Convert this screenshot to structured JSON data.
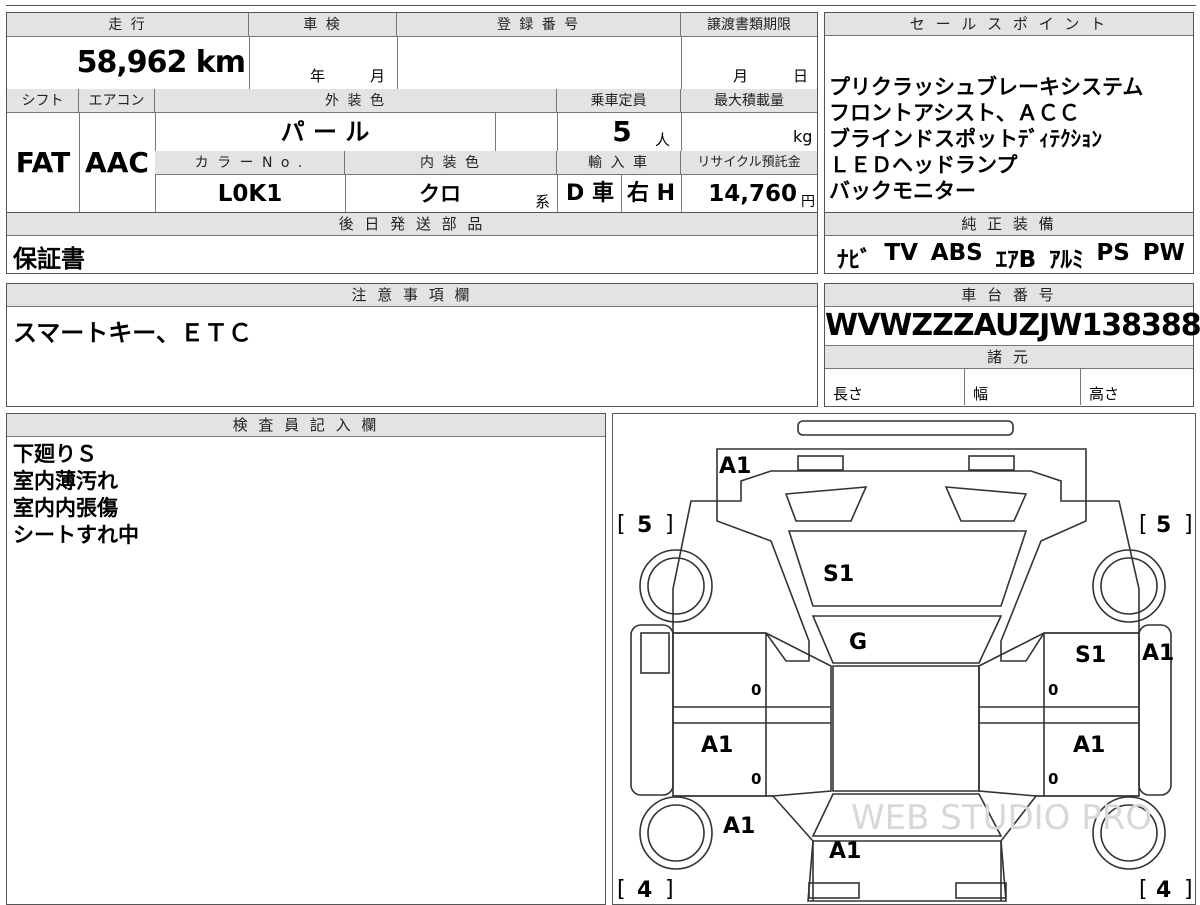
{
  "top_info": {
    "labels": {
      "mileage": "走 行",
      "shaken": "車 検",
      "registration": "登 録 番 号",
      "transfer_deadline": "譲渡書類期限",
      "shift": "シフト",
      "aircon": "エアコン",
      "exterior_color": "外 装 色",
      "capacity": "乗車定員",
      "max_load": "最大積載量",
      "color_no": "カ ラ ー N o .",
      "interior_color": "内 装 色",
      "import": "輸 入 車",
      "recycle": "リサイクル預託金"
    },
    "mileage_value": "58,962 km",
    "shaken_year_unit": "年",
    "shaken_month_unit": "月",
    "deadline_month_unit": "月",
    "deadline_day_unit": "日",
    "shift_value": "FAT",
    "aircon_value": "AAC",
    "exterior_color_value": "パ ー ル",
    "capacity_value": "5",
    "capacity_unit": "人",
    "max_load_unit": "kg",
    "color_no_value": "L0K1",
    "interior_color_value": "クロ",
    "interior_color_suffix": "系",
    "import_value_1": "D 車",
    "import_value_2": "右 H",
    "recycle_value": "14,760",
    "recycle_unit": "円"
  },
  "later_parts": {
    "header": "後 日 発 送 部 品",
    "value": "保証書"
  },
  "sales_points": {
    "header": "セ ー ル ス ポ イ ン ト",
    "lines": [
      "プリクラッシュブレーキシステム",
      "フロントアシスト、ＡＣＣ",
      "ブラインドスポットﾃﾞｨﾃｸｼｮﾝ",
      "ＬＥＤヘッドランプ",
      "バックモニター"
    ]
  },
  "equipment": {
    "header": "純 正 装 備",
    "items": [
      "ﾅﾋﾞ",
      "TV",
      "ABS",
      "ｴｱB",
      "ｱﾙﾐ",
      "PS",
      "PW"
    ]
  },
  "notes": {
    "header": "注 意 事 項 欄",
    "value": "スマートキー、ＥＴＣ"
  },
  "chassis": {
    "header": "車 台 番 号",
    "value": "WVWZZZAUZJW138388",
    "specs_header": "諸 元",
    "length_label": "長さ",
    "width_label": "幅",
    "height_label": "高さ"
  },
  "inspector": {
    "header": "検 査 員 記 入 欄",
    "lines": [
      "下廻りＳ",
      "室内薄汚れ",
      "室内内張傷",
      "シートすれ中"
    ]
  },
  "diagram": {
    "marks": {
      "front_bumper": "A1",
      "bonnet": "S1",
      "windshield": "G",
      "right_front_fender": "S1",
      "right_front_edge": "A1",
      "left_rear_door": "A1",
      "right_rear_door": "A1",
      "left_rear_quarter": "A1",
      "tailgate": "A1"
    },
    "tire_front_left": "5",
    "tire_front_right": "5",
    "tire_rear_left": "4",
    "tire_rear_right": "4",
    "door_zero": "0",
    "watermark": "WEB STUDIO PRO"
  }
}
